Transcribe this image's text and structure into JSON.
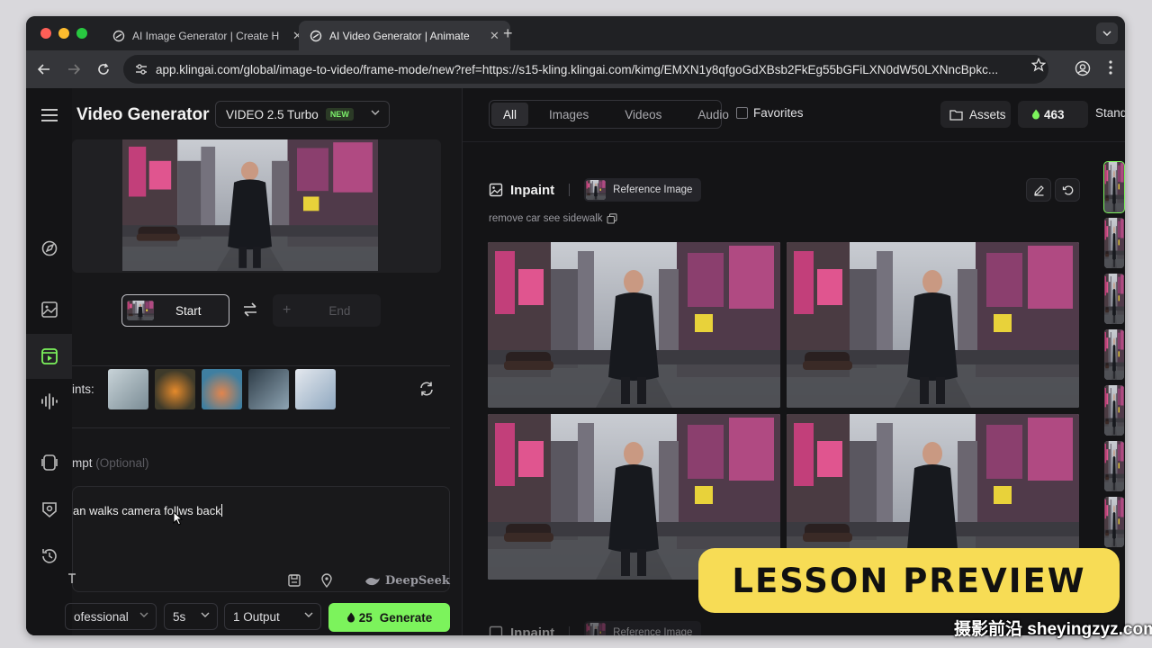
{
  "browser": {
    "tabs": [
      {
        "title": "AI Image Generator | Create H",
        "active": false
      },
      {
        "title": "AI Video Generator | Animate",
        "active": true
      }
    ],
    "url": "app.klingai.com/global/image-to-video/frame-mode/new?ref=https://s15-kling.klingai.com/kimg/EMXN1y8qfgoGdXBsb2FkEg55bGFiLXN0dW50LXNncBpkc..."
  },
  "left_panel": {
    "title": "Video Generator",
    "model": {
      "name": "VIDEO 2.5 Turbo",
      "badge": "NEW"
    },
    "start_label": "Start",
    "end_label": "End",
    "hints_label": "ints:",
    "prompt_label": "mpt",
    "prompt_optional": "(Optional)",
    "prompt_text": "an walks camera follws back",
    "deepseek_label": "DeepSeek",
    "mode": "ofessional",
    "duration": "5s",
    "outputs": "1 Output",
    "generate": {
      "cost": "25",
      "label": "Generate"
    }
  },
  "right_panel": {
    "filters": [
      "All",
      "Images",
      "Videos",
      "Audio"
    ],
    "active_filter": "All",
    "favorites_label": "Favorites",
    "assets_label": "Assets",
    "credits": "463",
    "standard_label": "Stand",
    "inpaint_title": "Inpaint",
    "reference_label": "Reference Image",
    "prompt_caption": "remove car see sidewalk",
    "second_inpaint_title": "Inpaint",
    "second_reference_label": "Reference Image"
  },
  "overlay": {
    "banner": "LESSON PREVIEW",
    "watermark": "摄影前沿 sheyingzyz.com"
  },
  "colors": {
    "accent_green": "#7cf35c",
    "banner_yellow": "#f7dc55",
    "background": "#141416"
  }
}
